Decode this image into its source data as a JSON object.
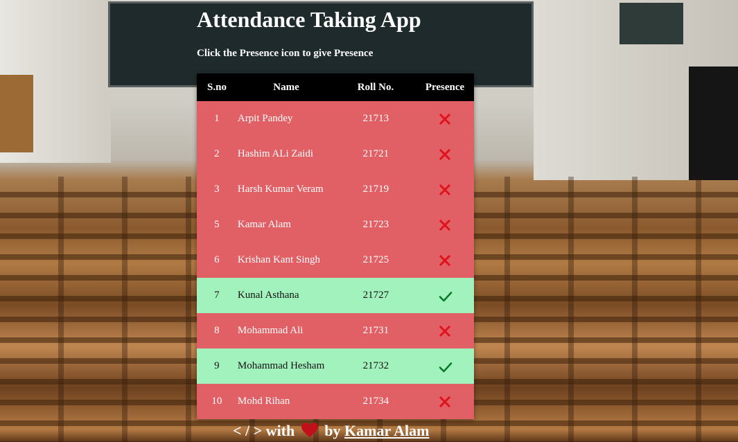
{
  "app": {
    "title": "Attendance Taking App",
    "subtitle": "Click the Presence icon to give Presence"
  },
  "table": {
    "headers": [
      "S.no",
      "Name",
      "Roll No.",
      "Presence"
    ],
    "rows": [
      {
        "sno": "1",
        "name": "Arpit Pandey",
        "roll": "21713",
        "present": false,
        "icon": "cross-icon"
      },
      {
        "sno": "2",
        "name": "Hashim ALi Zaidi",
        "roll": "21721",
        "present": false,
        "icon": "cross-icon"
      },
      {
        "sno": "3",
        "name": "Harsh Kumar Veram",
        "roll": "21719",
        "present": false,
        "icon": "cross-icon"
      },
      {
        "sno": "5",
        "name": "Kamar Alam",
        "roll": "21723",
        "present": false,
        "icon": "cross-icon"
      },
      {
        "sno": "6",
        "name": "Krishan Kant Singh",
        "roll": "21725",
        "present": false,
        "icon": "cross-icon"
      },
      {
        "sno": "7",
        "name": "Kunal Asthana",
        "roll": "21727",
        "present": true,
        "icon": "check-icon"
      },
      {
        "sno": "8",
        "name": "Mohammad Ali",
        "roll": "21731",
        "present": false,
        "icon": "cross-icon"
      },
      {
        "sno": "9",
        "name": "Mohammad Hesham",
        "roll": "21732",
        "present": true,
        "icon": "check-icon"
      },
      {
        "sno": "10",
        "name": "Mohd Rihan",
        "roll": "21734",
        "present": false,
        "icon": "cross-icon"
      }
    ]
  },
  "footer": {
    "prefix": "< / > with",
    "by": "by",
    "author": "Kamar Alam",
    "heart_icon": "heart-icon"
  },
  "colors": {
    "absent_row": "#e06066",
    "present_row": "#a2f2bd",
    "header_bg": "#000000",
    "cross": "#e0121c",
    "check": "#0a7a2a",
    "heart": "#c0101a"
  }
}
